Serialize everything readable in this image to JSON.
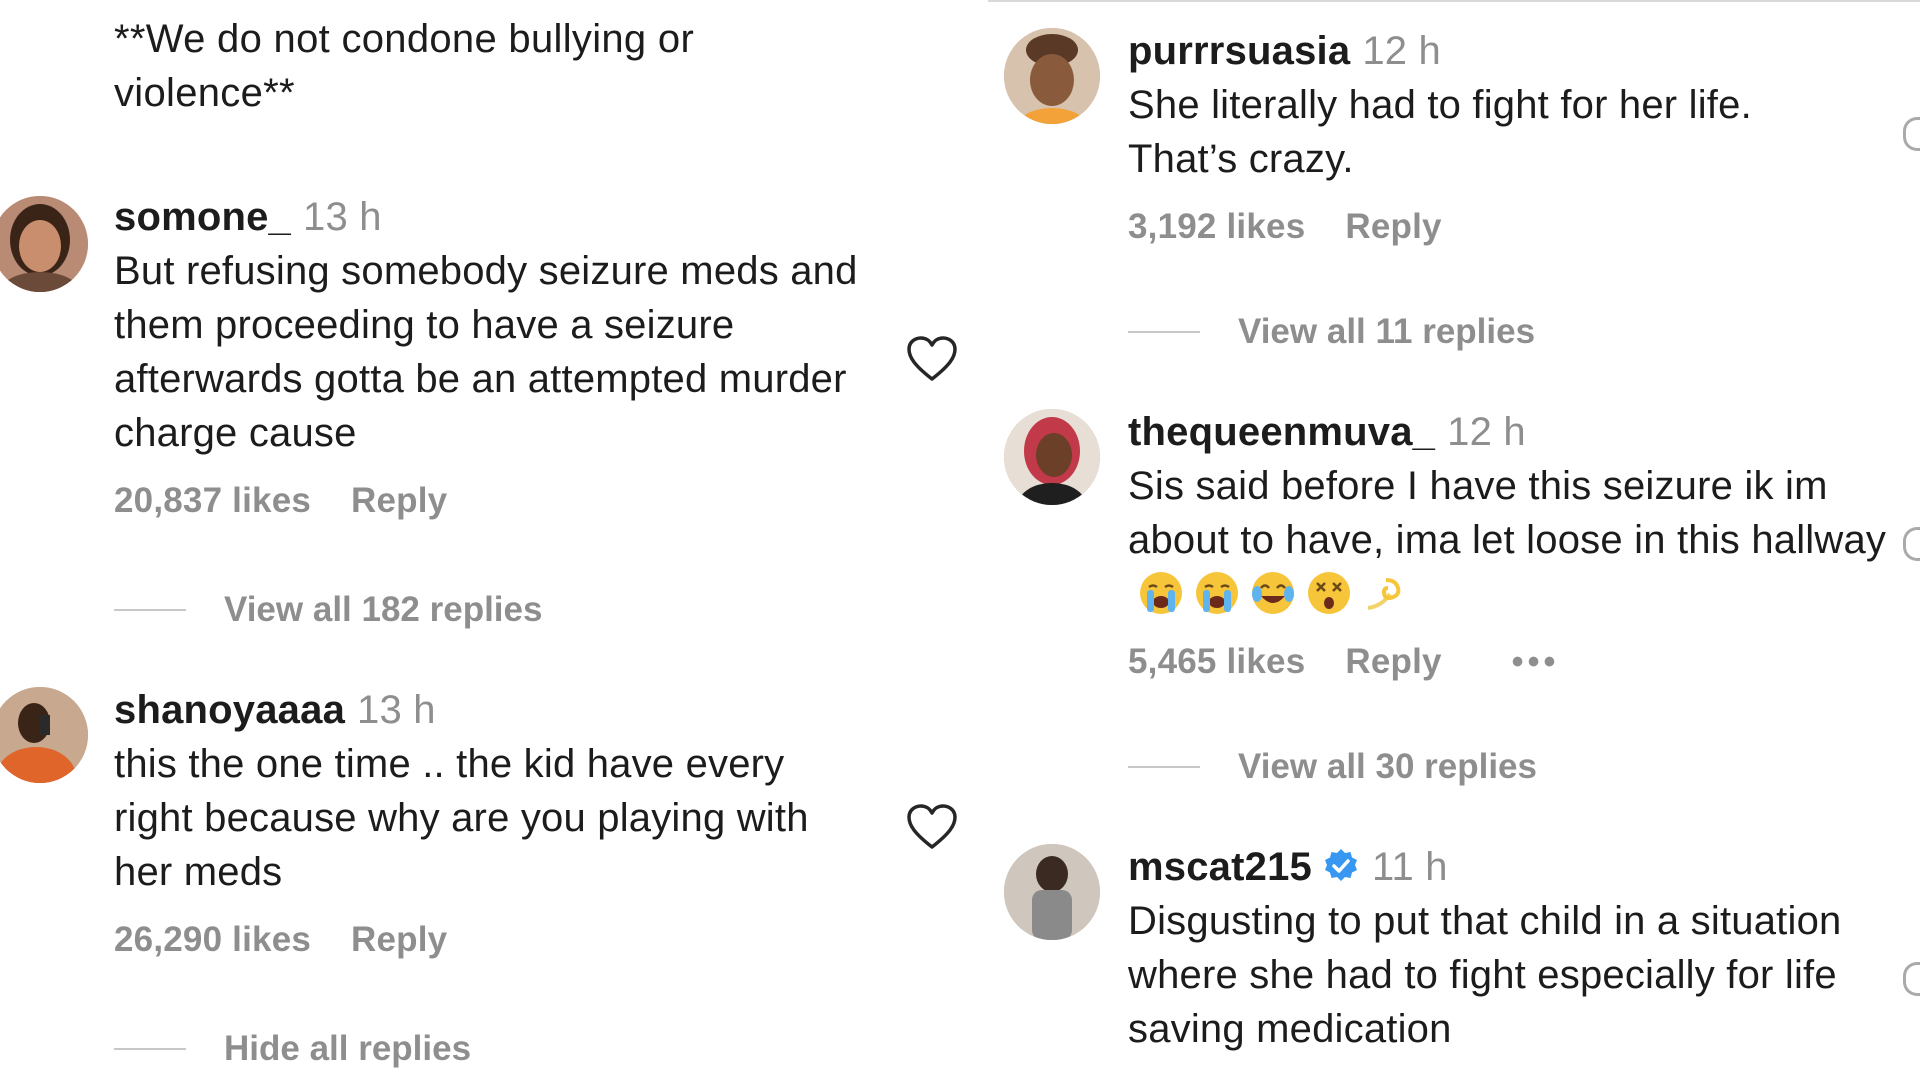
{
  "intro_text": "**We do not condone bullying or violence**",
  "left_comments": [
    {
      "username": "somone_",
      "time": "13 h",
      "text": "But refusing somebody seizure meds and them proceeding to have a seizure afterwards gotta be an attempted murder charge cause",
      "likes": "20,837 likes",
      "reply_label": "Reply",
      "replies_toggle": "View all 182 replies"
    },
    {
      "username": "shanoyaaaa",
      "time": "13 h",
      "text": "this the one time .. the kid have every right because why are you playing with her meds",
      "likes": "26,290 likes",
      "reply_label": "Reply",
      "replies_toggle": "Hide all replies"
    }
  ],
  "right_comments": [
    {
      "username": "purrrsuasia",
      "time": "12 h",
      "text": "She literally had to fight for her life. That’s crazy.",
      "likes": "3,192 likes",
      "reply_label": "Reply",
      "replies_toggle": "View all 11 replies"
    },
    {
      "username": "thequeenmuva_",
      "time": "12 h",
      "text": "Sis said before I have this seizure ik im about to have, ima let loose in this hallway",
      "emojis": [
        "loudly-crying-face",
        "loudly-crying-face",
        "face-with-tears-of-joy",
        "dizzy-face",
        "dizzy-symbol"
      ],
      "likes": "5,465 likes",
      "reply_label": "Reply",
      "more_label": "•••",
      "replies_toggle": "View all 30 replies"
    },
    {
      "username": "mscat215",
      "verified": true,
      "time": "11 h",
      "text": "Disgusting to put that child in a situation where she had to fight especially for life saving medication"
    }
  ],
  "icons": {
    "heart": "heart-outline-icon",
    "verified": "verified-badge-icon"
  },
  "colors": {
    "text": "#1c1c1c",
    "muted": "#8e8e8e",
    "verified": "#3897f0"
  }
}
